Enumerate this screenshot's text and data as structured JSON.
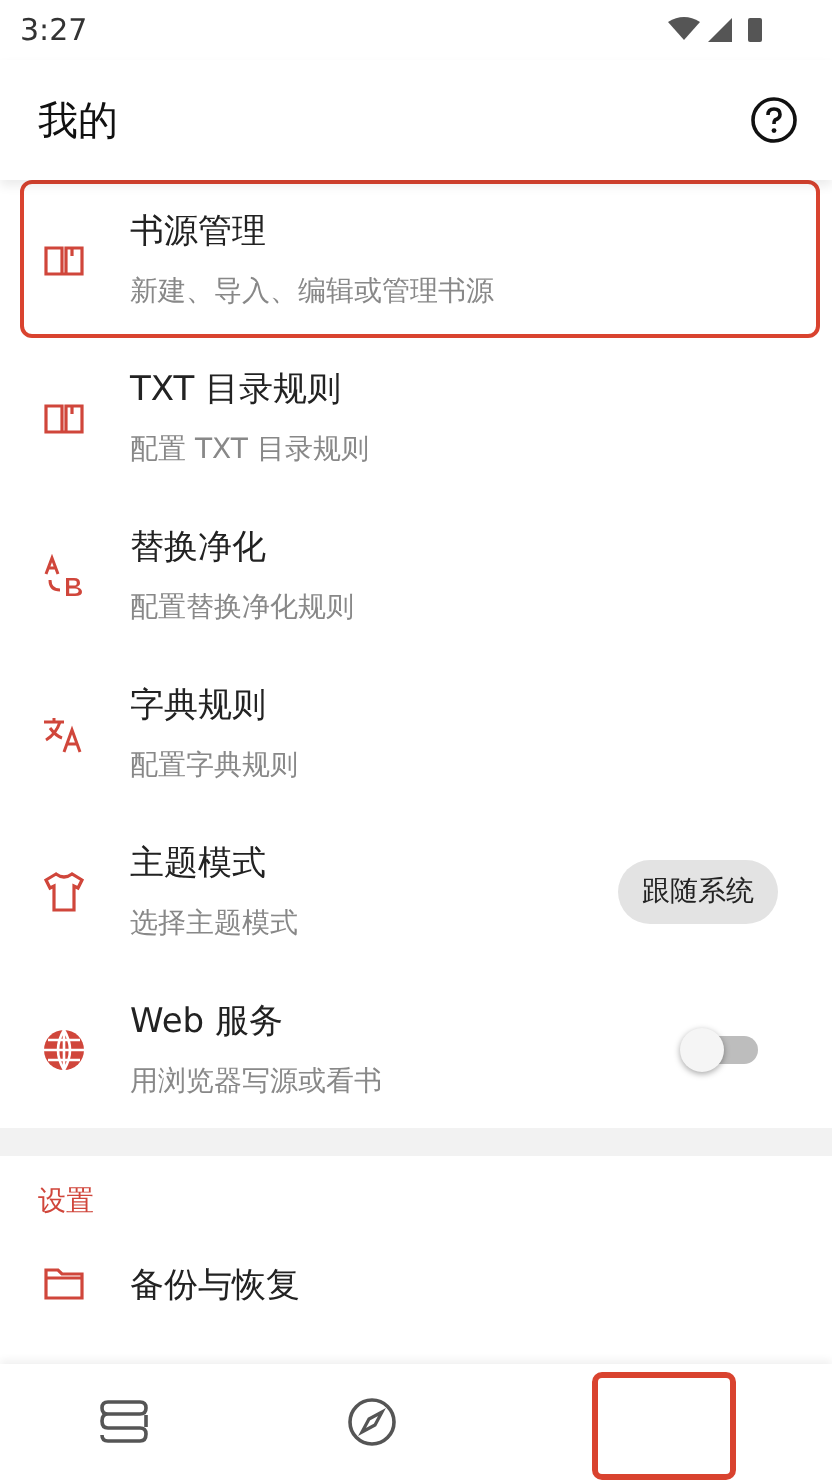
{
  "status_bar": {
    "time": "3:27"
  },
  "header": {
    "title": "我的"
  },
  "items": [
    {
      "kind": "link",
      "title": "书源管理",
      "subtitle": "新建、导入、编辑或管理书源",
      "highlighted": true
    },
    {
      "kind": "link",
      "title": "TXT 目录规则",
      "subtitle": "配置 TXT 目录规则",
      "highlighted": false
    },
    {
      "kind": "link",
      "title": "替换净化",
      "subtitle": "配置替换净化规则",
      "highlighted": false
    },
    {
      "kind": "link",
      "title": "字典规则",
      "subtitle": "配置字典规则",
      "highlighted": false
    },
    {
      "kind": "chip",
      "title": "主题模式",
      "subtitle": "选择主题模式",
      "value": "跟随系统",
      "highlighted": false
    },
    {
      "kind": "switch",
      "title": "Web 服务",
      "subtitle": "用浏览器写源或看书",
      "on": false,
      "highlighted": false
    }
  ],
  "settings": {
    "heading": "设置",
    "items": [
      {
        "title": "备份与恢复"
      }
    ]
  },
  "bottom_nav": {
    "highlight_last": true
  }
}
